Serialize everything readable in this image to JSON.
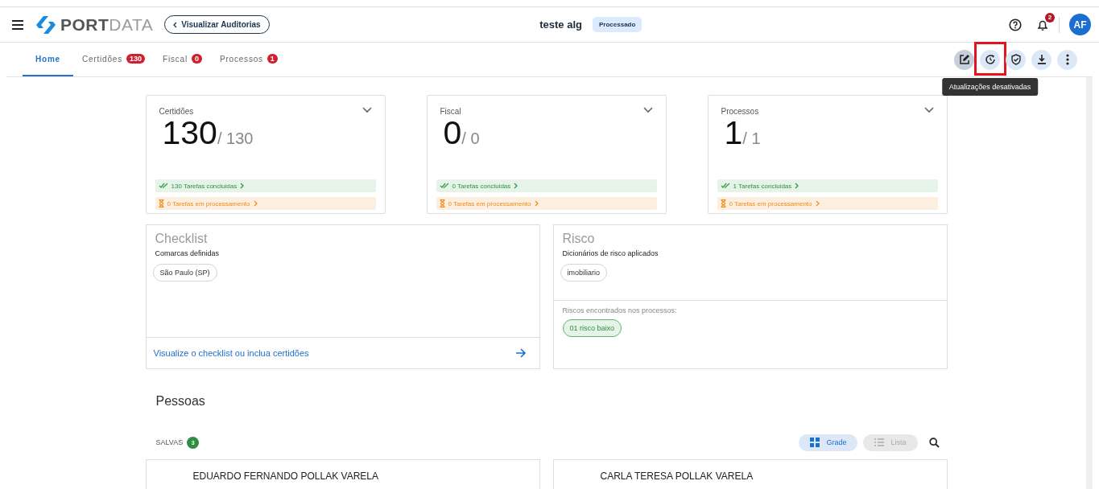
{
  "header": {
    "logo_bold": "PORT",
    "logo_light": "DATA",
    "back_button": "Visualizar Auditorias",
    "title": "teste alg",
    "status_badge": "Processado",
    "notification_count": "2",
    "avatar_initials": "AF"
  },
  "tabs": [
    {
      "label": "Home",
      "selected": true
    },
    {
      "label": "Certidões",
      "badge": "130",
      "selected": false
    },
    {
      "label": "Fiscal",
      "badge": "0",
      "selected": false
    },
    {
      "label": "Processos",
      "badge": "1",
      "selected": false
    }
  ],
  "toolbar": {
    "buttons": [
      {
        "kind": "edit",
        "pressed": true,
        "highlighted": false
      },
      {
        "kind": "refresh",
        "pressed": false,
        "highlighted": true
      },
      {
        "kind": "shield",
        "pressed": false,
        "highlighted": false
      },
      {
        "kind": "download",
        "pressed": false,
        "highlighted": false
      },
      {
        "kind": "more",
        "pressed": false,
        "highlighted": false
      }
    ],
    "tooltip": "Atualizações desativadas"
  },
  "summary_cards": [
    {
      "title": "Certidões",
      "value": "130",
      "total": "/ 130",
      "done": "130 Tarefas concluidas",
      "processing": "0 Tarefas em processamento"
    },
    {
      "title": "Fiscal",
      "value": "0",
      "total": "/ 0",
      "done": "0 Tarefas concluidas",
      "processing": "0 Tarefas em processamento"
    },
    {
      "title": "Processos",
      "value": "1",
      "total": "/ 1",
      "done": "1 Tarefas concluidas",
      "processing": "0 Tarefas em processamento"
    }
  ],
  "checklist": {
    "title": "Checklist",
    "subtitle": "Comarcas definidas",
    "chips": [
      "São Paulo (SP)"
    ],
    "link": "Visualize o checklist ou inclua certidões"
  },
  "risk": {
    "title": "Risco",
    "subtitle": "Dicionários de risco aplicados",
    "chips": [
      "imobiliario"
    ],
    "found_label": "Riscos encontrados nos processos:",
    "found_chips": [
      "01 risco baixo"
    ]
  },
  "people": {
    "title": "Pessoas",
    "saved_label": "SALVAS",
    "saved_count": "3",
    "views": [
      {
        "label": "Grade",
        "kind": "grid",
        "selected": true
      },
      {
        "label": "Lista",
        "kind": "list",
        "selected": false
      }
    ],
    "cards": [
      "EDUARDO FERNANDO POLLAK VARELA",
      "CARLA TERESA POLLAK VARELA"
    ]
  }
}
